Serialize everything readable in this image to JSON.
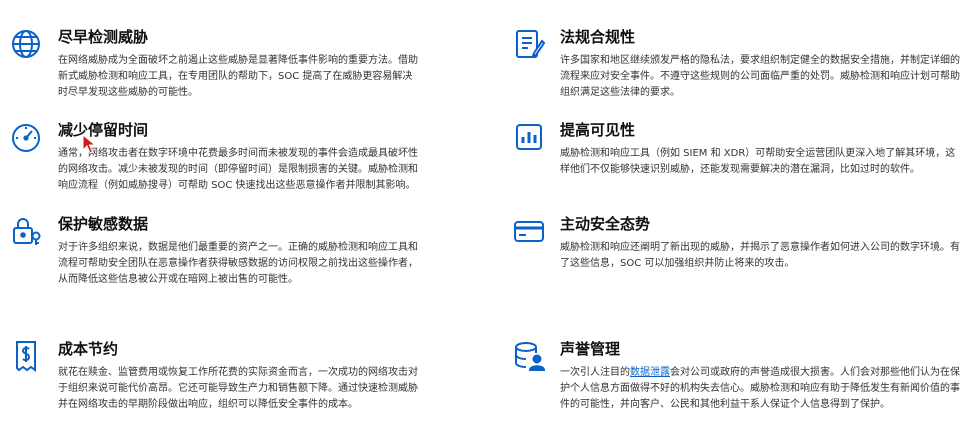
{
  "accent_color": "#0a62c9",
  "features": [
    {
      "icon": "globe-icon",
      "title": "尽早检测威胁",
      "desc": "在网络威胁成为全面破坏之前遏止这些威胁是显著降低事件影响的重要方法。借助新式威胁检测和响应工具，在专用团队的帮助下，SOC 提高了在威胁更容易解决时尽早发现这些威胁的可能性。"
    },
    {
      "icon": "compliance-document-icon",
      "title": "法规合规性",
      "desc": "许多国家和地区继续颁发严格的隐私法，要求组织制定健全的数据安全措施，并制定详细的流程来应对安全事件。不遵守这些规则的公司面临严重的处罚。威胁检测和响应计划可帮助组织满足这些法律的要求。"
    },
    {
      "icon": "speedometer-icon",
      "title": "减少停留时间",
      "desc": "通常，网络攻击者在数字环境中花费最多时间而未被发现的事件会造成最具破坏性的网络攻击。减少未被发现的时间（即停留时间）是限制损害的关键。威胁检测和响应流程（例如威胁搜寻）可帮助 SOC 快速找出这些恶意操作者并限制其影响。"
    },
    {
      "icon": "analytics-report-icon",
      "title": "提高可见性",
      "desc": "威胁检测和响应工具（例如 SIEM 和 XDR）可帮助安全运营团队更深入地了解其环境，这样他们不仅能够快速识别威胁，还能发现需要解决的潜在漏洞，比如过时的软件。"
    },
    {
      "icon": "lock-key-icon",
      "title": "保护敏感数据",
      "desc": "对于许多组织来说，数据是他们最重要的资产之一。正确的威胁检测和响应工具和流程可帮助安全团队在恶意操作者获得敏感数据的访问权限之前找出这些操作者，从而降低这些信息被公开或在暗网上被出售的可能性。"
    },
    {
      "icon": "credit-card-icon",
      "title": "主动安全态势",
      "desc": "威胁检测和响应还阐明了新出现的威胁，并揭示了恶意操作者如何进入公司的数字环境。有了这些信息，SOC 可以加强组织并防止将来的攻击。"
    },
    {
      "icon": "cost-receipt-icon",
      "title": "成本节约",
      "desc": "就花在赎金、监管费用或恢复工作所花费的实际资金而言，一次成功的网络攻击对于组织来说可能代价高昂。它还可能导致生产力和销售额下降。通过快速检测威胁并在网络攻击的早期阶段做出响应，组织可以降低安全事件的成本。"
    },
    {
      "icon": "database-user-icon",
      "title": "声誉管理",
      "desc_before": "一次引人注目的",
      "desc_link": "数据泄露",
      "desc_after": "会对公司或政府的声誉造成很大损害。人们会对那些他们认为在保护个人信息方面做得不好的机构失去信心。威胁检测和响应有助于降低发生有新闻价值的事件的可能性，并向客户、公民和其他利益干系人保证个人信息得到了保护。"
    }
  ]
}
